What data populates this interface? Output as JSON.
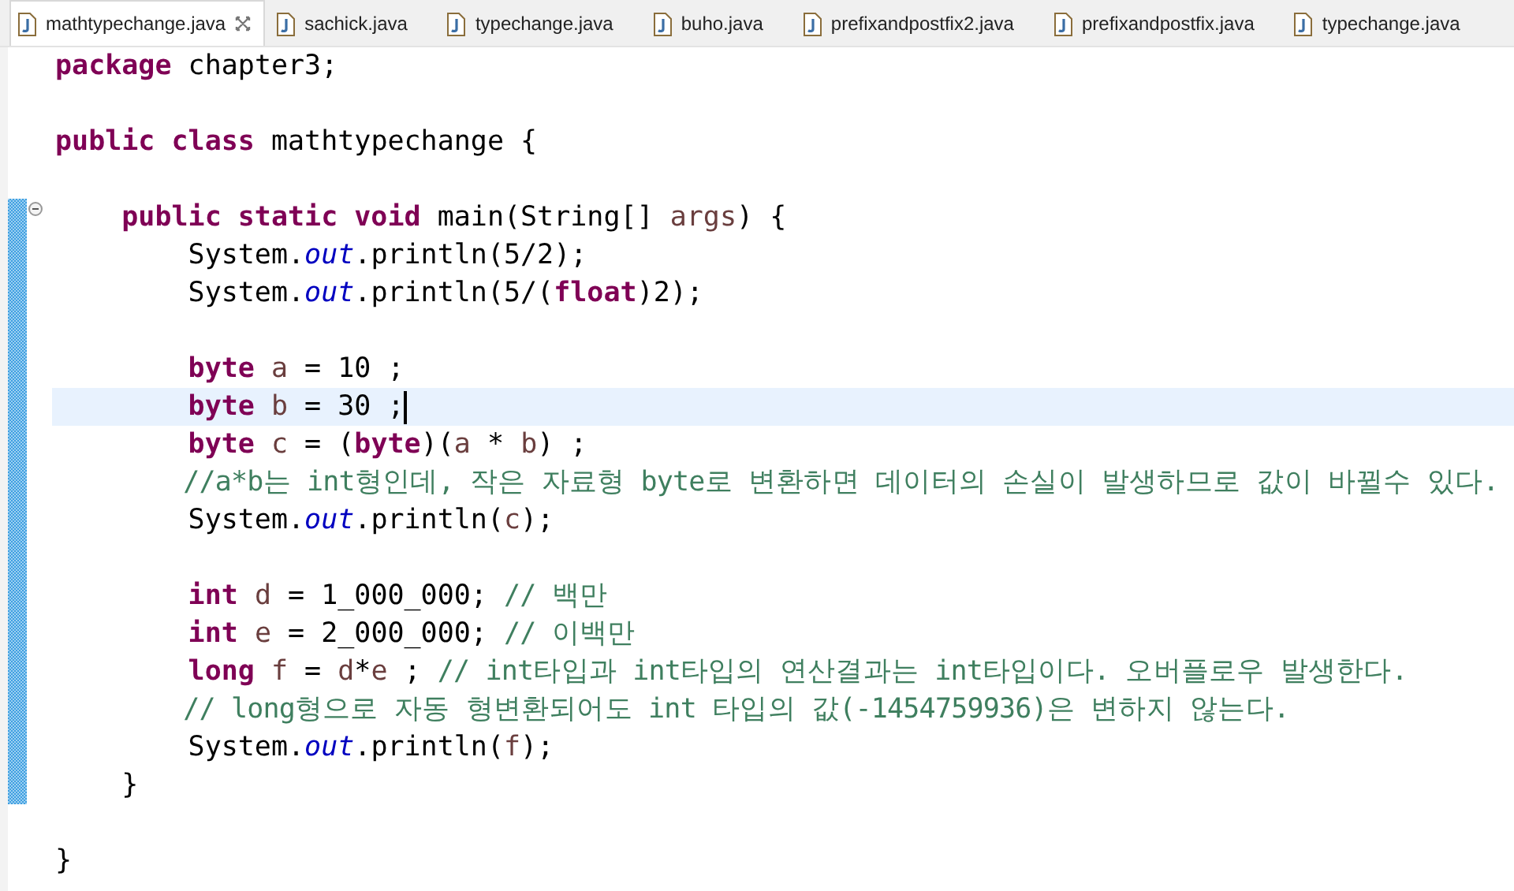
{
  "tabs": [
    {
      "label": "mathtypechange.java",
      "selected": true
    },
    {
      "label": "sachick.java",
      "selected": false
    },
    {
      "label": "typechange.java",
      "selected": false
    },
    {
      "label": "buho.java",
      "selected": false
    },
    {
      "label": "prefixandpostfix2.java",
      "selected": false
    },
    {
      "label": "prefixandpostfix.java",
      "selected": false
    },
    {
      "label": "typechange.java",
      "selected": false
    }
  ],
  "lines": [
    {
      "current": false,
      "changed": false,
      "collapsible": false,
      "tokens": [
        {
          "kind": "keyword",
          "text": "package"
        },
        {
          "kind": "plain",
          "text": " chapter3;"
        }
      ]
    },
    {
      "current": false,
      "changed": false,
      "collapsible": false
    },
    {
      "current": false,
      "changed": false,
      "collapsible": false,
      "tokens": [
        {
          "kind": "keyword",
          "text": "public class"
        },
        {
          "kind": "plain",
          "text": " mathtypechange {"
        }
      ]
    },
    {
      "current": false,
      "changed": false,
      "collapsible": false
    },
    {
      "current": false,
      "changed": true,
      "collapsible": true,
      "tokens": [
        {
          "kind": "keyword",
          "text": "    public static void"
        },
        {
          "kind": "plain",
          "text": " main(String[] "
        },
        {
          "kind": "variable",
          "text": "args"
        },
        {
          "kind": "plain",
          "text": ") {"
        }
      ]
    },
    {
      "current": false,
      "changed": true,
      "collapsible": false,
      "tokens": [
        {
          "kind": "plain",
          "text": "        System."
        },
        {
          "kind": "field",
          "text": "out"
        },
        {
          "kind": "plain",
          "text": ".println(5/2);"
        }
      ]
    },
    {
      "current": false,
      "changed": true,
      "collapsible": false,
      "tokens": [
        {
          "kind": "plain",
          "text": "        System."
        },
        {
          "kind": "field",
          "text": "out"
        },
        {
          "kind": "plain",
          "text": ".println(5/("
        },
        {
          "kind": "keyword",
          "text": "float"
        },
        {
          "kind": "plain",
          "text": ")2);"
        }
      ]
    },
    {
      "current": false,
      "changed": true,
      "collapsible": false
    },
    {
      "current": false,
      "changed": true,
      "collapsible": false,
      "tokens": [
        {
          "kind": "keyword",
          "text": "        byte"
        },
        {
          "kind": "variable",
          "text": " a"
        },
        {
          "kind": "plain",
          "text": " = 10 ;"
        }
      ]
    },
    {
      "current": true,
      "changed": true,
      "collapsible": false,
      "tokens": [
        {
          "kind": "keyword",
          "text": "        byte"
        },
        {
          "kind": "variable",
          "text": " b"
        },
        {
          "kind": "plain",
          "text": " = 30 ;"
        }
      ]
    },
    {
      "current": false,
      "changed": true,
      "collapsible": false,
      "tokens": [
        {
          "kind": "keyword",
          "text": "        byte"
        },
        {
          "kind": "variable",
          "text": " c"
        },
        {
          "kind": "plain",
          "text": " = ("
        },
        {
          "kind": "keyword",
          "text": "byte"
        },
        {
          "kind": "plain",
          "text": ")("
        },
        {
          "kind": "variable",
          "text": "a"
        },
        {
          "kind": "plain",
          "text": " * "
        },
        {
          "kind": "variable",
          "text": "b"
        },
        {
          "kind": "plain",
          "text": ") ;"
        }
      ]
    },
    {
      "current": false,
      "changed": true,
      "collapsible": false,
      "tokens": [
        {
          "kind": "comment",
          "text": "        //a*b는 int형인데, 작은 자료형 byte로 변환하면 데이터의 손실이 발생하므로 값이 바뀔수 있다."
        }
      ]
    },
    {
      "current": false,
      "changed": true,
      "collapsible": false,
      "tokens": [
        {
          "kind": "plain",
          "text": "        System."
        },
        {
          "kind": "field",
          "text": "out"
        },
        {
          "kind": "plain",
          "text": ".println("
        },
        {
          "kind": "variable",
          "text": "c"
        },
        {
          "kind": "plain",
          "text": ");"
        }
      ]
    },
    {
      "current": false,
      "changed": true,
      "collapsible": false
    },
    {
      "current": false,
      "changed": true,
      "collapsible": false,
      "tokens": [
        {
          "kind": "keyword",
          "text": "        int"
        },
        {
          "kind": "variable",
          "text": " d"
        },
        {
          "kind": "plain",
          "text": " = 1_000_000; "
        },
        {
          "kind": "comment",
          "text": "// 백만"
        }
      ]
    },
    {
      "current": false,
      "changed": true,
      "collapsible": false,
      "tokens": [
        {
          "kind": "keyword",
          "text": "        int"
        },
        {
          "kind": "variable",
          "text": " e"
        },
        {
          "kind": "plain",
          "text": " = 2_000_000; "
        },
        {
          "kind": "comment",
          "text": "// 이백만"
        }
      ]
    },
    {
      "current": false,
      "changed": true,
      "collapsible": false,
      "tokens": [
        {
          "kind": "keyword",
          "text": "        long"
        },
        {
          "kind": "variable",
          "text": " f"
        },
        {
          "kind": "plain",
          "text": " = "
        },
        {
          "kind": "variable",
          "text": "d"
        },
        {
          "kind": "plain",
          "text": "*"
        },
        {
          "kind": "variable",
          "text": "e"
        },
        {
          "kind": "plain",
          "text": " ; "
        },
        {
          "kind": "comment",
          "text": "// int타입과 int타입의 연산결과는 int타입이다. 오버플로우 발생한다."
        }
      ]
    },
    {
      "current": false,
      "changed": true,
      "collapsible": false,
      "tokens": [
        {
          "kind": "comment",
          "text": "        // long형으로 자동 형변환되어도 int 타입의 값(-1454759936)은 변하지 않는다."
        }
      ]
    },
    {
      "current": false,
      "changed": true,
      "collapsible": false,
      "tokens": [
        {
          "kind": "plain",
          "text": "        System."
        },
        {
          "kind": "field",
          "text": "out"
        },
        {
          "kind": "plain",
          "text": ".println("
        },
        {
          "kind": "variable",
          "text": "f"
        },
        {
          "kind": "plain",
          "text": ");"
        }
      ]
    },
    {
      "current": false,
      "changed": true,
      "collapsible": false,
      "tokens": [
        {
          "kind": "plain",
          "text": "    }"
        }
      ]
    },
    {
      "current": false,
      "changed": false,
      "collapsible": false
    },
    {
      "current": false,
      "changed": false,
      "collapsible": false,
      "tokens": [
        {
          "kind": "plain",
          "text": "}"
        }
      ]
    }
  ]
}
